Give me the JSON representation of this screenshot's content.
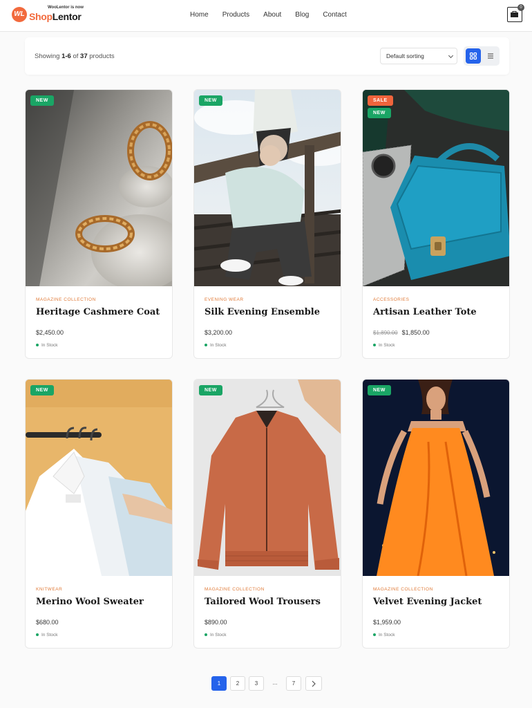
{
  "header": {
    "logo_top": "WooLentor is now",
    "logo_mark": "WL",
    "logo_name_a": "Shop",
    "logo_name_b": "Lentor",
    "nav": [
      "Home",
      "Products",
      "About",
      "Blog",
      "Contact"
    ],
    "cart_count": "0"
  },
  "toolbar": {
    "showing_prefix": "Showing ",
    "showing_range": "1-6",
    "showing_mid": " of ",
    "showing_total": "37",
    "showing_suffix": " products",
    "sort_value": "Default sorting"
  },
  "products": [
    {
      "badges": [
        "NEW"
      ],
      "category": "MAGAZINE COLLECTION",
      "title": "Heritage Cashmere Coat",
      "price": "$2,450.00",
      "old_price": "",
      "stock": "In Stock"
    },
    {
      "badges": [
        "NEW"
      ],
      "category": "EVENING WEAR",
      "title": "Silk Evening Ensemble",
      "price": "$3,200.00",
      "old_price": "",
      "stock": "In Stock"
    },
    {
      "badges": [
        "SALE",
        "NEW"
      ],
      "category": "ACCESSORIES",
      "title": "Artisan Leather Tote",
      "price": "$1,850.00",
      "old_price": "$1,890.00",
      "stock": "In Stock"
    },
    {
      "badges": [
        "NEW"
      ],
      "category": "KNITWEAR",
      "title": "Merino Wool Sweater",
      "price": "$680.00",
      "old_price": "",
      "stock": "In Stock"
    },
    {
      "badges": [
        "NEW"
      ],
      "category": "MAGAZINE COLLECTION",
      "title": "Tailored Wool Trousers",
      "price": "$890.00",
      "old_price": "",
      "stock": "In Stock"
    },
    {
      "badges": [
        "NEW"
      ],
      "category": "MAGAZINE COLLECTION",
      "title": "Velvet Evening Jacket",
      "price": "$1,959.00",
      "old_price": "",
      "stock": "In Stock"
    }
  ],
  "pagination": {
    "pages": [
      "1",
      "2",
      "3",
      "...",
      "7"
    ],
    "active": "1"
  },
  "colors": {
    "accent": "#2563eb",
    "badge_new": "#1aa565",
    "badge_sale": "#f0643c",
    "category": "#e07b39",
    "brand": "#f26a3d"
  }
}
